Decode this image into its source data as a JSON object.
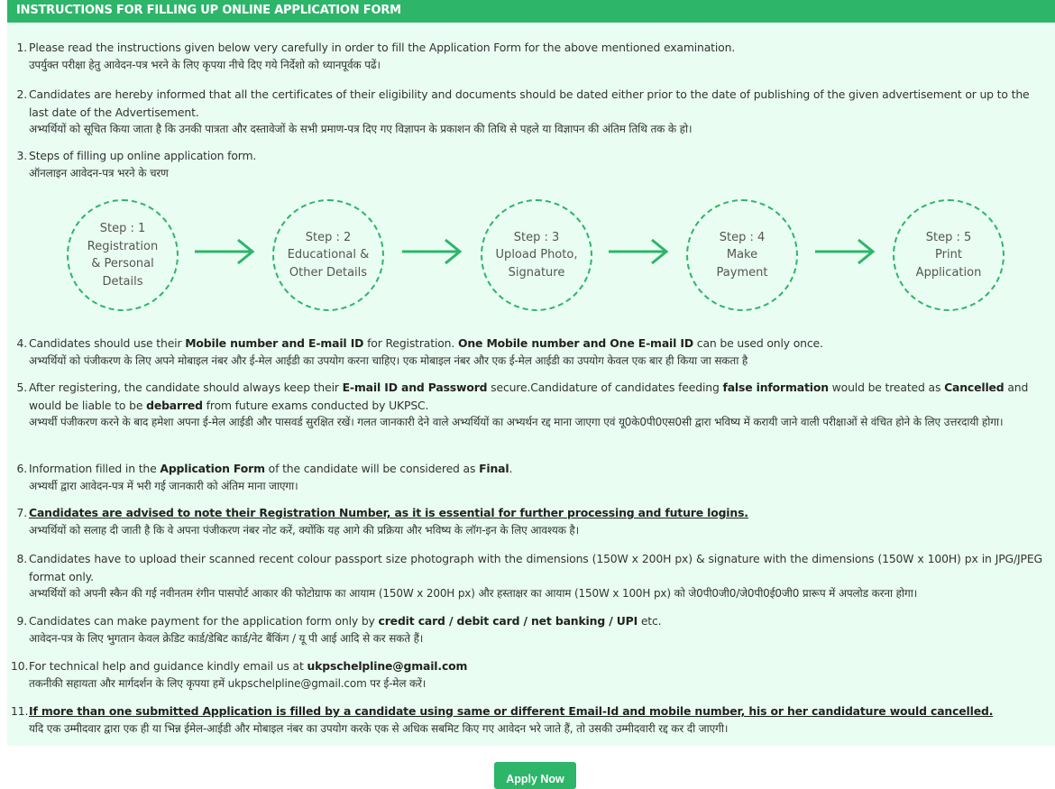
{
  "header": {
    "title": "INSTRUCTIONS FOR FILLING UP ONLINE APPLICATION FORM"
  },
  "colors": {
    "accent": "#2db56a",
    "panel": "#e9fdf2"
  },
  "items": [
    {
      "num": "1.",
      "en": [
        "Please read the instructions given below very carefully in order to fill the Application Form for the above mentioned examination."
      ],
      "hi": "उपर्युक्त परीक्षा हेतु आवेदन-पत्र भरने के लिए कृपया नीचे दिए गये निर्देशो को ध्यानपूर्वक पढें।"
    },
    {
      "num": "2.",
      "en": [
        "Candidates are hereby informed that all the certificates of their eligibility and documents should be dated either prior to the date of publishing of the given advertisement or up to the last date of the Advertisement."
      ],
      "hi": "अभ्यर्थियों को सूचित किया जाता है कि उनकी पात्रता और दस्तावेजों के सभी प्रमाण-पत्र दिए गए विज्ञापन के प्रकाशन की तिथि से पहले या विज्ञापन की अंतिम तिथि तक के हो।"
    },
    {
      "num": "3.",
      "en": [
        "Steps of filling up online application form."
      ],
      "hi": "ऑनलाइन आवेदन-पत्र भरने के चरण"
    },
    {
      "num": "4.",
      "en": [
        "Candidates should use their ",
        "Mobile number and E-mail ID",
        " for Registration. ",
        "One Mobile number and One E-mail ID",
        " can be used only once."
      ],
      "hi": "अभ्यर्थियों को पंजीकरण के लिए अपने मोबाइल नंबर और ई-मेल आईडी का उपयोग करना चाहिए। एक मोबाइल नंबर और एक ई-मेल आईडी का उपयोग केवल एक बार ही किया जा सकता है"
    },
    {
      "num": "5.",
      "en": [
        "After registering, the candidate should always keep their ",
        "E-mail ID and Password",
        " secure.Candidature of candidates feeding ",
        "false information",
        " would be treated as ",
        "Cancelled",
        " and would be liable to be ",
        "debarred",
        " from future exams conducted by UKPSC."
      ],
      "hi": "अभ्यर्थी पंजीकरण करने के बाद हमेशा अपना ई-मेल आईडी और पासवर्ड सुरक्षित रखें। गलत जानकारी देने वाले अभ्यर्थियों का अभ्यर्थन रद्द माना जाएगा एवं यू0के0पी0एस0सी द्वारा भविष्य में करायी जाने वाली परीक्षाओं से वंचित होने के लिए उत्तरदायी होगा।"
    },
    {
      "num": "6.",
      "en": [
        "Information filled in the ",
        "Application Form",
        " of the candidate will be considered as ",
        "Final",
        "."
      ],
      "hi": "अभ्यर्थी द्वारा आवेदन-पत्र में भरी गई जानकारी को अंतिम माना जाएगा।"
    },
    {
      "num": "7.",
      "en": [
        "Candidates are advised to note their Registration Number, as it is essential for further processing and future logins."
      ],
      "hi": "अभ्यर्थियों को सलाह दी जाती है कि वे अपना पंजीकरण नंबर नोट करें, क्योंकि यह आगे की प्रक्रिया और भविष्य के लॉग-इन के लिए आवश्यक है।"
    },
    {
      "num": "8.",
      "en": [
        "Candidates have to upload their scanned recent colour passport size photograph with the dimensions (150W x 200H px) & signature with the dimensions (150W x 100H) px in JPG/JPEG format only."
      ],
      "hi": "अभ्यर्थियों को अपनी स्कैन की गई नवीनतम रंगीन पासपोर्ट आकार की फोटोग्राफ का आयाम (150W x 200H px) और हस्ताक्षर का आयाम (150W x 100H px) को जे0पी0जी0/जे0पी0ई0जी0 प्रारूप में अपलोड करना होगा।"
    },
    {
      "num": "9.",
      "en": [
        "Candidates can make payment for the application form only by ",
        "credit card / debit card / net banking / UPI",
        " etc."
      ],
      "hi": "आवेदन-पत्र के लिए भुगतान केवल क्रेडिट कार्ड/डेबिट कार्ड/नेट बैंकिंग / यू पी आई आदि से कर सकते हैं।"
    },
    {
      "num": "10.",
      "en": [
        "For technical help and guidance kindly email us at ",
        "ukpschelpline@gmail.com"
      ],
      "hi": "तकनीकी सहायता और मार्गदर्शन के लिए कृपया हमें ukpschelpline@gmail.com पर ई-मेल करें।"
    },
    {
      "num": "11.",
      "en": [
        "If more than one submitted Application is filled by a candidate using same or different Email-Id and mobile number, his or her candidature would cancelled."
      ],
      "hi": "यदि एक उम्मीदवार द्वारा एक ही या भिन्न ईमेल-आईडी और मोबाइल नंबर का उपयोग करके एक से अधिक सबमिट किए गए आवेदन भरे जाते हैं, तो उसकी उम्मीदवारी रद्द कर दी जाएगी।"
    }
  ],
  "steps": [
    "Step : 1\nRegistration\n& Personal\nDetails",
    "Step : 2\nEducational &\nOther Details",
    "Step : 3\nUpload Photo,\nSignature",
    "Step : 4\nMake\nPayment",
    "Step : 5\nPrint\nApplication"
  ],
  "apply_button": "Apply Now"
}
